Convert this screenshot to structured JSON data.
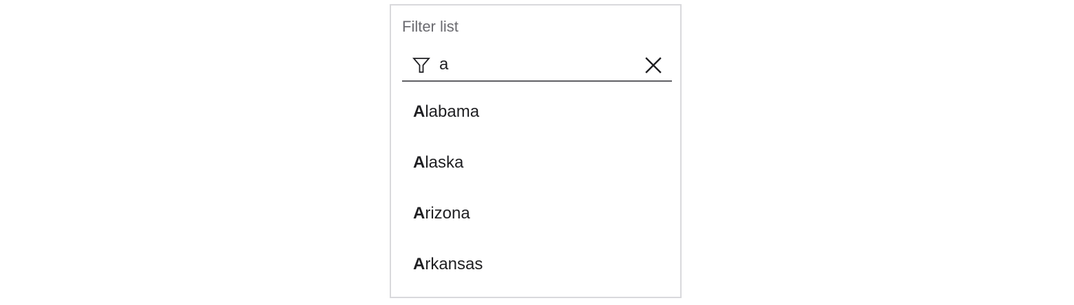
{
  "filter": {
    "title": "Filter list",
    "query": "a",
    "filter_icon": "filter-icon",
    "clear_icon": "close-icon"
  },
  "items": [
    {
      "match": "A",
      "rest": "labama"
    },
    {
      "match": "A",
      "rest": "laska"
    },
    {
      "match": "A",
      "rest": "rizona"
    },
    {
      "match": "A",
      "rest": "rkansas"
    }
  ]
}
